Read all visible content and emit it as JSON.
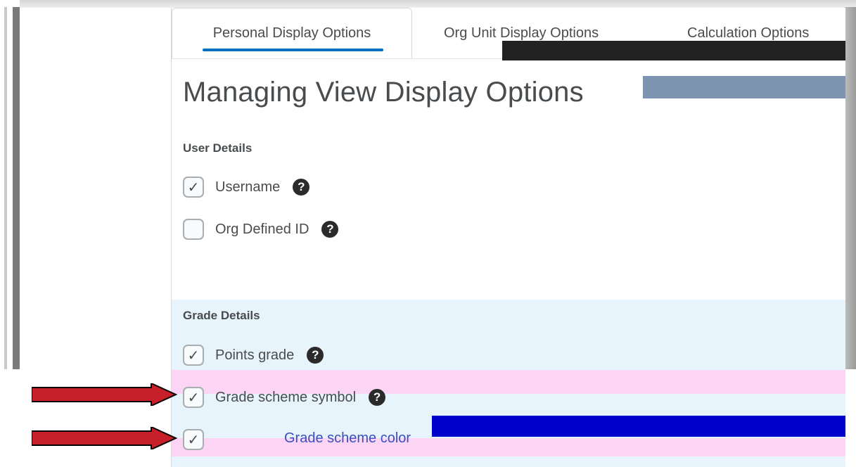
{
  "tabs": [
    {
      "label": "Personal Display Options",
      "active": true
    },
    {
      "label": "Org Unit Display Options",
      "active": false
    },
    {
      "label": "Calculation Options",
      "active": false
    }
  ],
  "page_title": "Managing View Display Options",
  "user_details": {
    "heading": "User Details",
    "options": [
      {
        "label": "Username",
        "checked": true,
        "help_icon": "question-circle-icon"
      },
      {
        "label": "Org Defined ID",
        "checked": false,
        "help_icon": "question-circle-icon"
      }
    ]
  },
  "grade_details": {
    "heading": "Grade Details",
    "options": [
      {
        "label": "Points grade",
        "checked": true,
        "help_icon": "question-circle-icon"
      },
      {
        "label": "Grade scheme symbol",
        "checked": true,
        "help_icon": "question-circle-icon"
      },
      {
        "label": "Grade scheme color",
        "checked": true
      }
    ]
  },
  "colors": {
    "accent": "#006fbf",
    "grade_band": "#e8f4fb",
    "arrow": "#c8202a",
    "text": "#494c4e"
  }
}
